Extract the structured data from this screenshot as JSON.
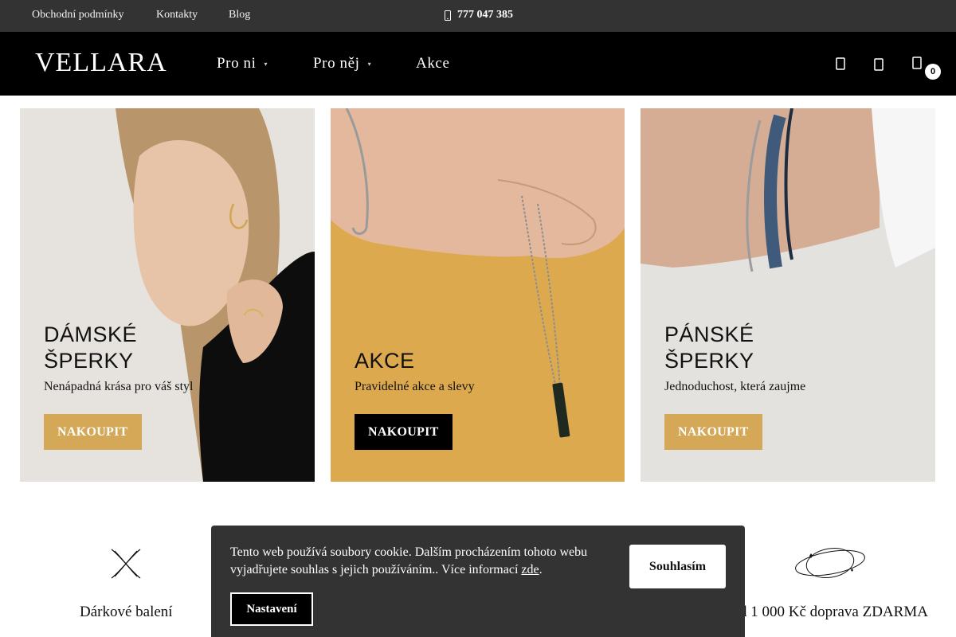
{
  "topbar": {
    "links": [
      "Obchodní podmínky",
      "Kontakty",
      "Blog"
    ],
    "phone": "777 047 385"
  },
  "header": {
    "logo": "VELLARA",
    "nav": [
      {
        "label": "Pro ni",
        "has_dropdown": true
      },
      {
        "label": "Pro něj",
        "has_dropdown": true
      },
      {
        "label": "Akce",
        "has_dropdown": false
      }
    ],
    "icons": [
      "search-icon",
      "user-icon",
      "cart-icon"
    ],
    "cart_count": "0"
  },
  "banners": [
    {
      "title_lines": [
        "DÁMSKÉ",
        "ŠPERKY"
      ],
      "subtitle": "Nenápadná krása pro váš styl",
      "button": "NAKOUPIT",
      "button_color": "#d4a856",
      "background": "#e6e3df"
    },
    {
      "title_lines": [
        "AKCE"
      ],
      "subtitle": "Pravidelné akce a slevy",
      "button": "NAKOUPIT",
      "button_color": "#000000",
      "background": "#dca94f"
    },
    {
      "title_lines": [
        "PÁNSKÉ",
        "ŠPERKY"
      ],
      "subtitle": "Jednoduchost, která zaujme",
      "button": "NAKOUPIT",
      "button_color": "#d4a856",
      "background": "#e4e2df"
    }
  ],
  "features": [
    {
      "label": "Dárkové balení",
      "icon": "gift-bow-icon"
    },
    {
      "label": "d 1 000 Kč doprava ZDARMA",
      "icon": "delivery-orbit-icon"
    }
  ],
  "cookie": {
    "text": "Tento web používá soubory cookie. Dalším procházením tohoto webu vyjadřujete souhlas s jejich používáním.. Více informací ",
    "link": "zde",
    "after_link": ".",
    "agree_button": "Souhlasím",
    "settings_button": "Nastavení"
  },
  "colors": {
    "topbar": "#333333",
    "header": "#000000",
    "accent_gold": "#d4a856",
    "cookie_bg": "#333333"
  }
}
